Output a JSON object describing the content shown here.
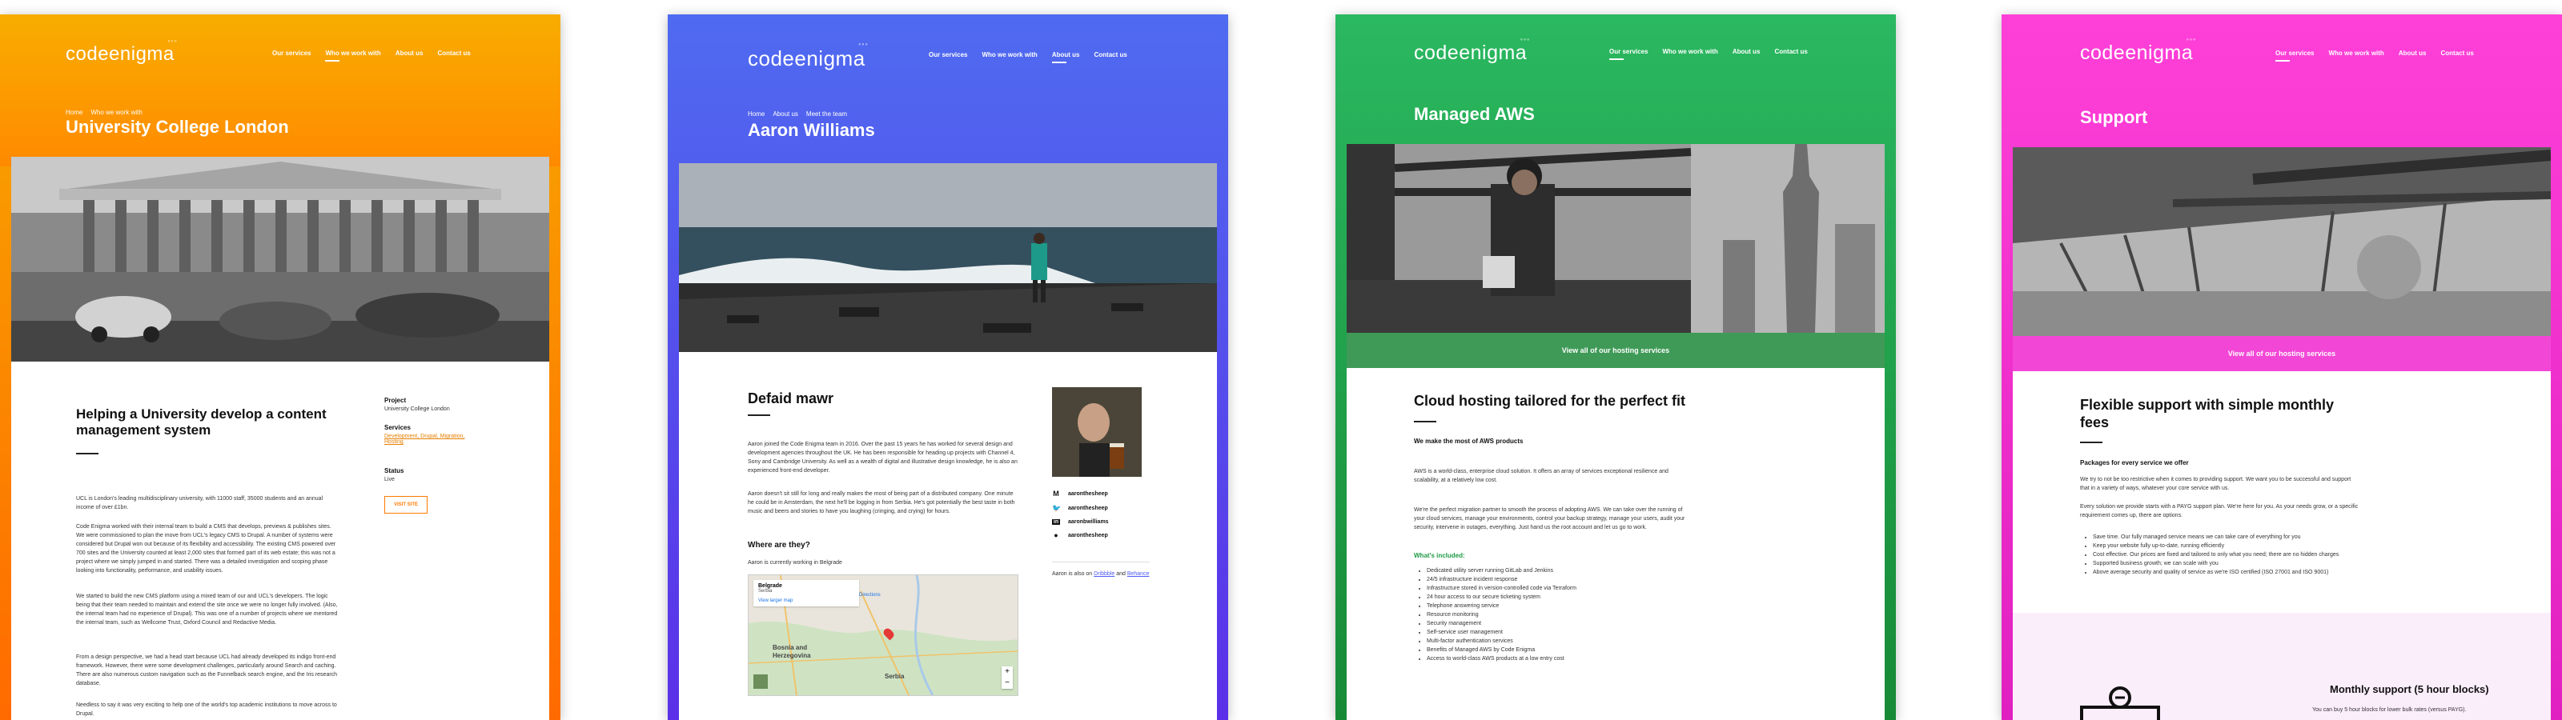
{
  "cards": [
    {
      "theme": {
        "from": "#f7a800",
        "to": "#ff6a00"
      },
      "logo": "codeenigma",
      "nav": [
        "Our services",
        "Who we work with",
        "About us",
        "Contact us"
      ],
      "active_nav": "Who we work with",
      "breadcrumbs": [
        "Home",
        "Who we work with"
      ],
      "title": "University College London",
      "section_title": "Helping a University develop a content management system",
      "paragraphs": [
        "UCL is London's leading multidisciplinary university, with 11000 staff, 35000 students and an annual income of over £1bn.",
        "Code Enigma worked with their internal team to build a CMS that develops, previews & publishes sites. We were commissioned to plan the move from UCL's legacy CMS to Drupal. A number of systems were considered but Drupal won out because of its flexibility and accessibility. The existing CMS powered over 700 sites and the University counted at least 2,000 sites that formed part of its web estate; this was not a project where we simply jumped in and started. There was a detailed investigation and scoping phase looking into functionality, performance, and usability issues.",
        "We started to build the new CMS platform using a mixed team of our and UCL's developers. The logic being that their team needed to maintain and extend the site once we were no longer fully involved. (Also, the internal team had no experience of Drupal). This was one of a number of projects where we mentored the internal team, such as Wellcome Trust, Oxford Council and Redactive Media.",
        "From a design perspective, we had a head start because UCL had already developed its indigo front-end framework. However, there were some development challenges, particularly around Search and caching. There are also numerous custom navigation such as the Funnelback search engine, and the Iris research database.",
        "Needless to say it was very exciting to help one of the world's top academic institutions to move across to Drupal."
      ],
      "project_label": "Project",
      "project_value": "University College London",
      "services_label": "Services",
      "services_value": "Development, Drupal, Migration, Hosting",
      "status_label": "Status",
      "status_value": "Live",
      "visit_button": "VISIT SITE"
    },
    {
      "theme": {
        "from": "#4f6bf0",
        "to": "#5b30e8"
      },
      "logo": "codeenigma",
      "nav": [
        "Our services",
        "Who we work with",
        "About us",
        "Contact us"
      ],
      "active_nav": "About us",
      "breadcrumbs": [
        "Home",
        "About us",
        "Meet the team"
      ],
      "title": "Aaron Williams",
      "section_title": "Defaid mawr",
      "paragraphs": [
        "Aaron joined the Code Enigma team in 2016. Over the past 15 years he has worked for several design and development agencies throughout the UK. He has been responsible for heading up projects with Channel 4, Sony and Cambridge University. As well as a wealth of digital and illustrative design knowledge, he is also an experienced front-end developer.",
        "Aaron doesn't sit still for long and really makes the most of being part of a distributed company. One minute he could be in Amsterdam, the next he'll be logging in from Serbia. He's got potentially the best taste in both music and beers and stories to have you laughing (cringing, and crying) for hours."
      ],
      "where_heading": "Where are they?",
      "where_text": "Aaron is currently working in Belgrade",
      "map": {
        "place": "Belgrade",
        "sub": "Serbia",
        "view_link": "View larger map",
        "directions": "Directions",
        "region1": "Bosnia and",
        "region2": "Herzegovina",
        "country": "Serbia"
      },
      "social": [
        "aaronthesheep",
        "aaronthesheep",
        "aaronbwilliams",
        "aaronthesheep"
      ],
      "also_on_prefix": "Aaron is also on",
      "also_on_1": "Dribbble",
      "also_on_and": "and",
      "also_on_2": "Behance"
    },
    {
      "theme": {
        "from": "#2ab860",
        "to": "#1a9a3e"
      },
      "logo": "codeenigma",
      "nav": [
        "Our services",
        "Who we work with",
        "About us",
        "Contact us"
      ],
      "active_nav": "Our services",
      "title": "Managed AWS",
      "button_bar": "View all of our hosting services",
      "section_title": "Cloud hosting tailored for the perfect fit",
      "lead": "We make the most of AWS products",
      "paragraphs": [
        "AWS is a world-class, enterprise cloud solution. It offers an array of services exceptional resilience and scalability, at a relatively low cost.",
        "We're the perfect migration partner to smooth the process of adopting AWS. We can take over the running of your cloud services, manage your environments, control your backup strategy, manage your users, audit your security, intervene in outages, everything. Just hand us the root account and let us go to work."
      ],
      "included_heading": "What's included:",
      "included": [
        "Dedicated utility server running GitLab and Jenkins",
        "24/5 infrastructure incident response",
        "Infrastructure stored in version-controlled code via Terraform",
        "24 hour access to our secure ticketing system",
        "Telephone answering service",
        "Resource monitoring",
        "Security management",
        "Self-service user management",
        "Multi-factor authentication services",
        "Benefits of Managed AWS by Code Enigma",
        "Access to world-class AWS products at a low entry cost"
      ]
    },
    {
      "theme": {
        "from": "#ff40d8",
        "to": "#e020c0"
      },
      "logo": "codeenigma",
      "nav": [
        "Our services",
        "Who we work with",
        "About us",
        "Contact us"
      ],
      "active_nav": "Our services",
      "title": "Support",
      "button_bar": "View all of our hosting services",
      "section_title": "Flexible support with simple monthly fees",
      "lead": "Packages for every service we offer",
      "paragraphs": [
        "We try to not be too restrictive when it comes to providing support. We want you to be successful and support that in a variety of ways, whatever your core service with us.",
        "Every solution we provide starts with a PAYG support plan. We're here for you. As your needs grow, or a specific requirement comes up, there are options."
      ],
      "bullets": [
        "Save time. Our fully managed service means we can take care of everything for you",
        "Keep your website fully up-to-date, running efficiently",
        "Cost effective. Our prices are fixed and tailored to only what you need; there are no hidden charges",
        "Supported business growth; we can scale with you",
        "Above average security and quality of service as we're ISO certified (ISO 27001 and ISO 9001)"
      ],
      "plan_title": "Monthly support (5 hour blocks)",
      "plan_text": "You can buy 5 hour blocks for lower bulk rates (versus PAYG)."
    }
  ]
}
